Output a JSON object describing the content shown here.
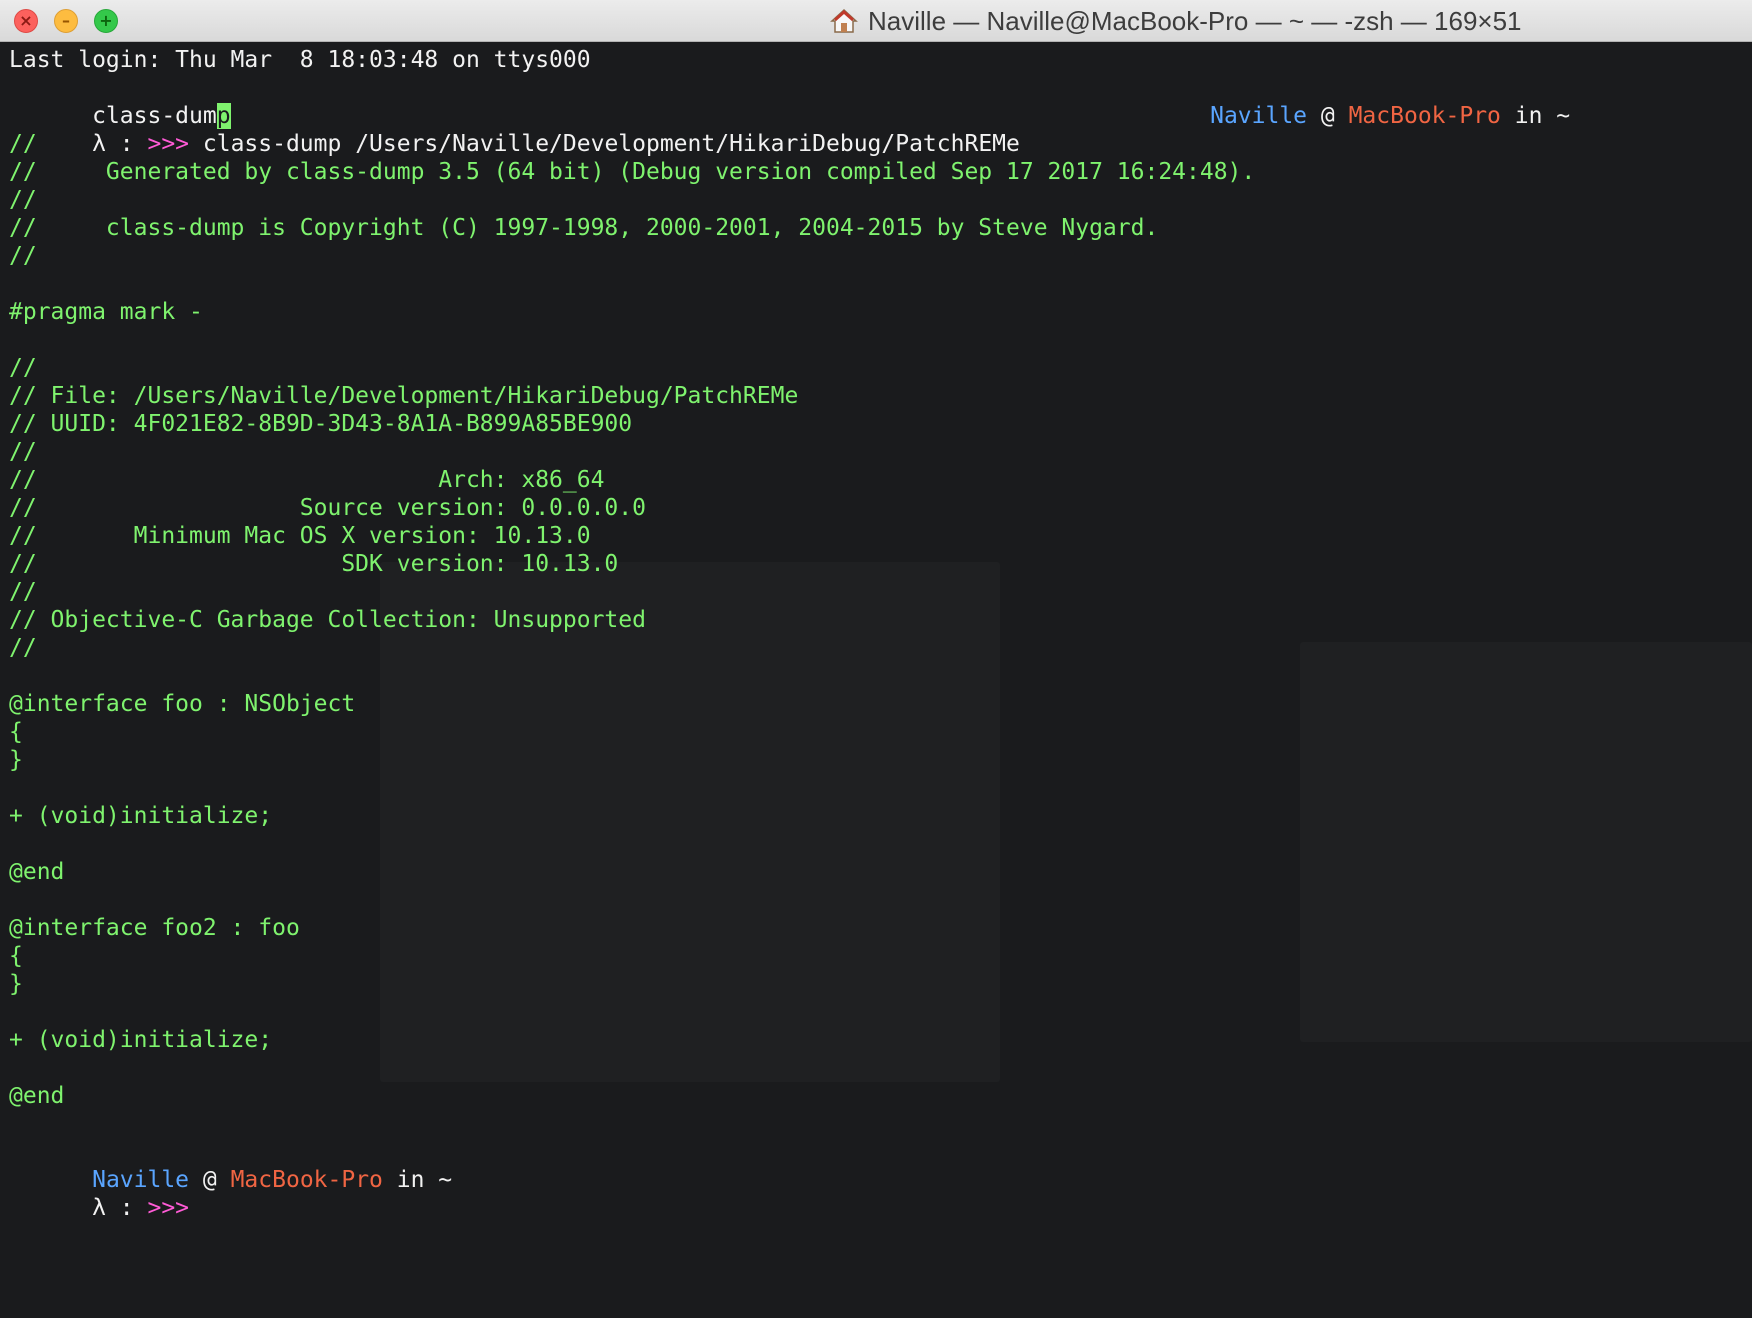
{
  "window": {
    "title": "Naville — Naville@MacBook-Pro — ~ — -zsh — 169×51",
    "colors": {
      "background": "#1a1b1d",
      "text_green": "#7ff36e",
      "user_blue": "#5aa5ff",
      "host_red": "#f06543",
      "prompt_magenta": "#ff5bd6",
      "white": "#f2f2f2"
    },
    "icons": [
      "close-icon",
      "minimize-icon",
      "zoom-icon",
      "home-icon"
    ]
  },
  "terminal": {
    "last_login": "Last login: Thu Mar  8 18:03:48 on ttys000",
    "typed_prefix": "class-dum",
    "cursor_char": "p",
    "right_prompt": {
      "user": "Naville",
      "at": " @ ",
      "host": "MacBook-Pro",
      "in": " in ~"
    },
    "prompt": {
      "lambda": "λ : ",
      "arrows": ">>> ",
      "command": "class-dump /Users/Naville/Development/HikariDebug/PatchREMe"
    },
    "output": [
      "//",
      "//     Generated by class-dump 3.5 (64 bit) (Debug version compiled Sep 17 2017 16:24:48).",
      "//",
      "//     class-dump is Copyright (C) 1997-1998, 2000-2001, 2004-2015 by Steve Nygard.",
      "//",
      "",
      "#pragma mark -",
      "",
      "//",
      "// File: /Users/Naville/Development/HikariDebug/PatchREMe",
      "// UUID: 4F021E82-8B9D-3D43-8A1A-B899A85BE900",
      "//",
      "//                             Arch: x86_64",
      "//                   Source version: 0.0.0.0.0",
      "//       Minimum Mac OS X version: 10.13.0",
      "//                      SDK version: 10.13.0",
      "//",
      "// Objective-C Garbage Collection: Unsupported",
      "//",
      "",
      "@interface foo : NSObject",
      "{",
      "}",
      "",
      "+ (void)initialize;",
      "",
      "@end",
      "",
      "@interface foo2 : foo",
      "{",
      "}",
      "",
      "+ (void)initialize;",
      "",
      "@end",
      ""
    ],
    "final_prompt": {
      "user": "Naville",
      "at": " @ ",
      "host": "MacBook-Pro",
      "in": " in ~",
      "lambda": "λ : ",
      "arrows": ">>>"
    }
  }
}
